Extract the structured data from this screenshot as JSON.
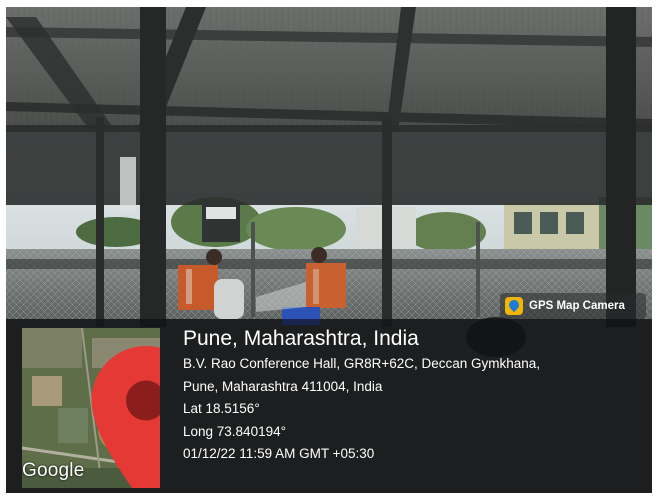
{
  "overlay": {
    "badge": {
      "label": "GPS Map Camera",
      "icon": "gps-map-camera-icon"
    },
    "map": {
      "brand": "Google",
      "pin_icon": "location-pin-icon",
      "pin_color": "#e53935"
    },
    "location": {
      "city": "Pune, Maharashtra, India",
      "address_line1": "B.V. Rao Conference Hall, GR8R+62C, Deccan Gymkhana,",
      "address_line2": "Pune, Maharashtra 411004, India",
      "lat": "Lat 18.5156°",
      "long": "Long 73.840194°",
      "timestamp": "01/12/22 11:59 AM GMT +05:30"
    }
  }
}
